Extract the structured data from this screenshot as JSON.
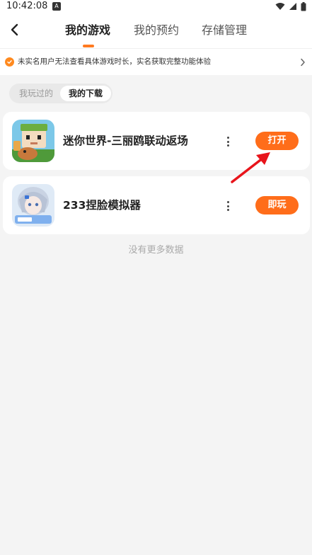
{
  "status_bar": {
    "time": "10:42:08",
    "app_icon": "A"
  },
  "header": {
    "tabs": [
      {
        "label": "我的游戏",
        "active": true
      },
      {
        "label": "我的预约",
        "active": false
      },
      {
        "label": "存储管理",
        "active": false
      }
    ]
  },
  "notice": {
    "text": "未实名用户无法查看具体游戏时长，实名获取完整功能体验"
  },
  "segment": {
    "played": "我玩过的",
    "downloads": "我的下载"
  },
  "games": [
    {
      "name": "迷你世界-三丽鸥联动返场",
      "action": "打开",
      "icon": "mini-world-icon"
    },
    {
      "name": "233捏脸模拟器",
      "action": "即玩",
      "icon": "face-simulator-icon"
    }
  ],
  "footer": {
    "no_more": "没有更多数据"
  },
  "colors": {
    "accent": "#ff6d1a",
    "annotation": "#e8141b"
  }
}
